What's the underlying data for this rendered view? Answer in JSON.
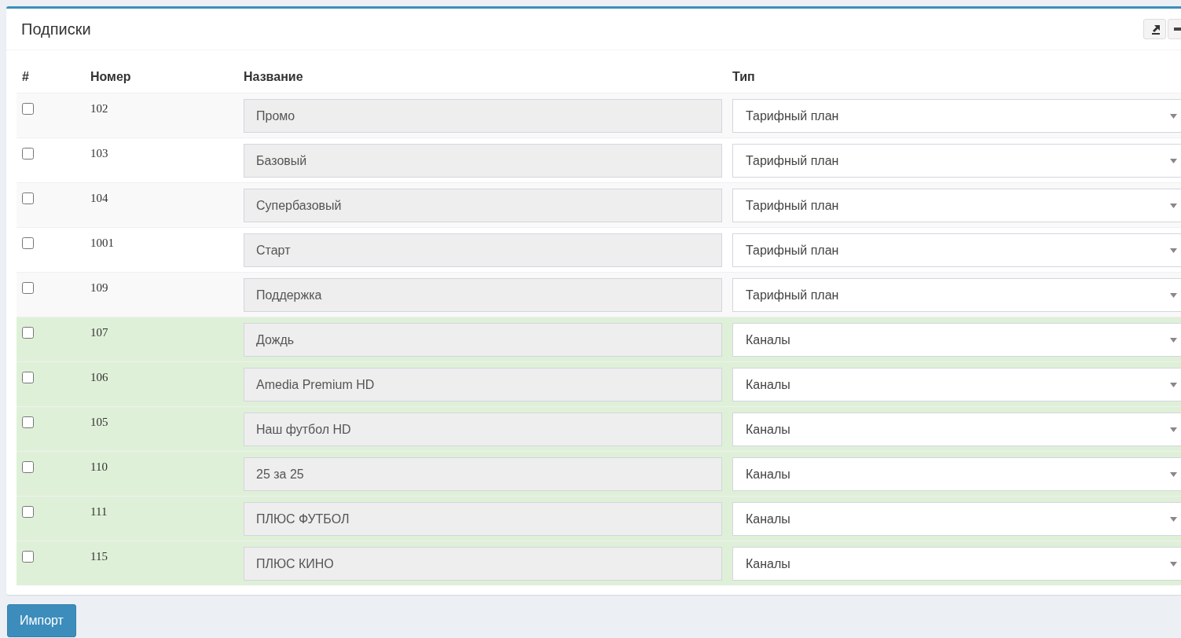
{
  "panel": {
    "title": "Подписки"
  },
  "table": {
    "columns": [
      "#",
      "Номер",
      "Название",
      "Тип"
    ],
    "rows": [
      {
        "checked": false,
        "number": "102",
        "name": "Промо",
        "type": "Тарифный план",
        "highlighted": false
      },
      {
        "checked": false,
        "number": "103",
        "name": "Базовый",
        "type": "Тарифный план",
        "highlighted": false
      },
      {
        "checked": false,
        "number": "104",
        "name": "Супербазовый",
        "type": "Тарифный план",
        "highlighted": false
      },
      {
        "checked": false,
        "number": "1001",
        "name": "Старт",
        "type": "Тарифный план",
        "highlighted": false
      },
      {
        "checked": false,
        "number": "109",
        "name": "Поддержка",
        "type": "Тарифный план",
        "highlighted": false
      },
      {
        "checked": false,
        "number": "107",
        "name": "Дождь",
        "type": "Каналы",
        "highlighted": true
      },
      {
        "checked": false,
        "number": "106",
        "name": "Amedia Premium HD",
        "type": "Каналы",
        "highlighted": true
      },
      {
        "checked": false,
        "number": "105",
        "name": "Наш футбол HD",
        "type": "Каналы",
        "highlighted": true
      },
      {
        "checked": false,
        "number": "110",
        "name": "25 за 25",
        "type": "Каналы",
        "highlighted": true
      },
      {
        "checked": false,
        "number": "111",
        "name": "ПЛЮС ФУТБОЛ",
        "type": "Каналы",
        "highlighted": true
      },
      {
        "checked": false,
        "number": "115",
        "name": "ПЛЮС КИНО",
        "type": "Каналы",
        "highlighted": true
      }
    ]
  },
  "buttons": [
    "Импорт"
  ]
}
